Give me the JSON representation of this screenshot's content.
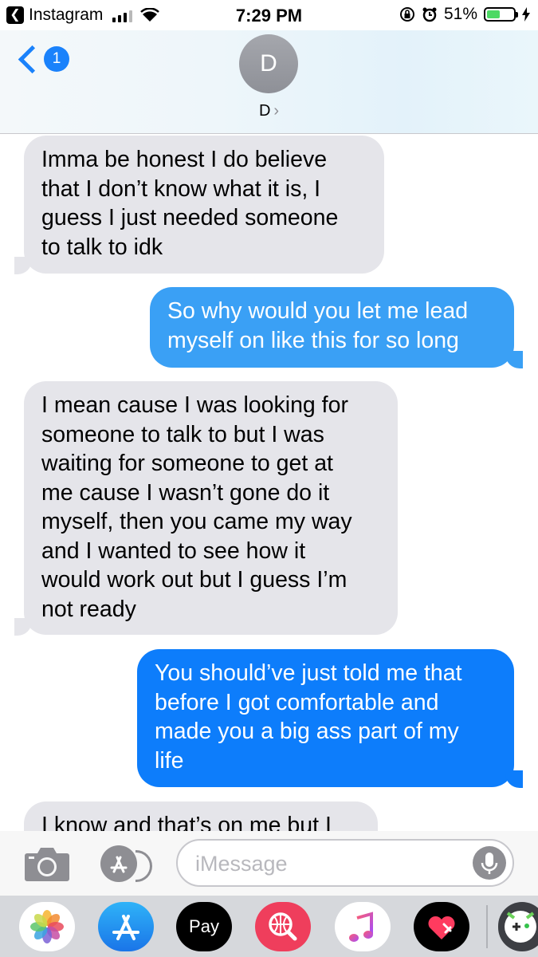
{
  "status_bar": {
    "back_app": "Instagram",
    "back_glyph": "❮",
    "time": "7:29 PM",
    "battery_percent": "51%",
    "battery_level": 0.51,
    "signal_bars_active": 3,
    "icons": [
      "signal-icon",
      "wifi-icon",
      "orientation-lock-icon",
      "alarm-icon",
      "battery-icon",
      "charging-bolt-icon"
    ]
  },
  "header": {
    "back_badge": "1",
    "avatar_initial": "D",
    "contact_name": "D",
    "name_chevron": "›"
  },
  "messages": [
    {
      "direction": "incoming",
      "lines": [
        "Imma be honest I do believe",
        "that I don’t know what it is, I",
        "guess I just needed someone",
        "to talk to idk"
      ]
    },
    {
      "direction": "outgoing",
      "lines": [
        "So why would you let me lead",
        "myself on like this for so long"
      ]
    },
    {
      "direction": "incoming",
      "lines": [
        "I mean cause I was looking for",
        "someone to talk to but I was",
        "waiting for someone to get at",
        "me cause I wasn’t gone do it",
        "myself, then you came my way",
        "and I wanted to see how it",
        "would work out but I guess I’m",
        "not ready"
      ]
    },
    {
      "direction": "outgoing",
      "lines": [
        "You should’ve just told me that",
        "before I got comfortable and",
        "made you a big ass part of my",
        "life"
      ]
    },
    {
      "direction": "incoming",
      "lines": [
        "I know and that’s on me but I"
      ]
    }
  ],
  "composer": {
    "placeholder": "iMessage",
    "value": ""
  },
  "app_tray": {
    "apps": [
      "photos-app-icon",
      "app-store-app-icon",
      "apple-pay-app-icon",
      "image-search-app-icon",
      "music-app-icon",
      "digital-touch-app-icon",
      "game-app-icon"
    ],
    "apple_pay_label": "Pay",
    "apple_pay_glyph": ""
  },
  "colors": {
    "incoming_bubble": "#e5e5ea",
    "outgoing_top": "#3aa0f5",
    "outgoing_bottom": "#0a7bfb",
    "accent": "#1a82fb"
  }
}
